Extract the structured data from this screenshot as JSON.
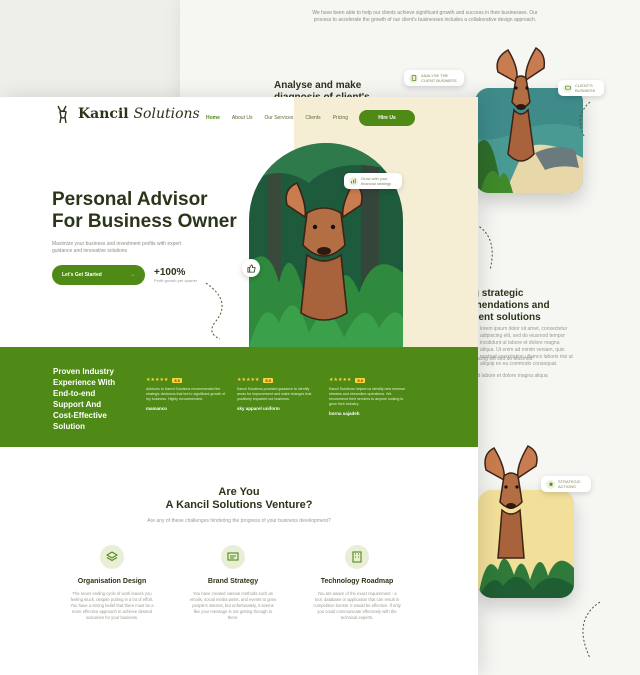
{
  "back": {
    "intro": "We have been able to help our clients achieve significant growth and success in their businesses. Our process to accelerate the growth of our client's businesses includes a collaborative design approach.",
    "section1_title": "Analyse and make\ndiagnosis of client's",
    "chip1": "ANALYSE THE\nCLIENT BUSINESS",
    "chip2": "CLIENT'S\nBUSINESS",
    "section2_title": "ing strategic\nmmendations and\nement solutions",
    "section2_body": "lorem ipsum dolor sit amet, consectetur adipiscing elit, sed do eiusmod tempor incididunt ut labore et dolore magna aliqua. Ut enim ad minim veniam, quis nostrud exercitation ullamco laboris nisi ut aliquip ex ea commodo consequat.",
    "bullet1": "acing elit sed do eiusmod",
    "bullet2": "ut labore et dolore magna aliqua",
    "chip3": "STRATEGIC\nACTIONS"
  },
  "header": {
    "brand_bold": "Kancil",
    "brand_script": "Solutions",
    "nav": [
      "Home",
      "About Us",
      "Our Services",
      "Clients",
      "Pricing"
    ],
    "hire": "Hire Us"
  },
  "hero": {
    "title": "Personal Advisor\nFor Business Owner",
    "subtitle": "Maximize your business and investment profits with expert guidance and innovative solutions",
    "cta": "Let's Get Started",
    "stat_value": "+100%",
    "stat_label": "Profit growth per quarter",
    "chip": "Grow with your\nfinancial strategy"
  },
  "band": {
    "title": "Proven Industry\nExperience With\nEnd-to-end\nSupport And\nCost-Effective\nSolution",
    "reviews": [
      {
        "rating": "5.0",
        "text": "Advisors to Kancil Solutions recommended the strategic decisions that led to significant growth of my business. Highly recommended.",
        "name": "mamanco"
      },
      {
        "rating": "5.0",
        "text": "Kancil Solutions provided guidance to identify areas for improvement and make changes that positively impacted our business.",
        "name": "sky apparel uniform"
      },
      {
        "rating": "5.0",
        "text": "Kancil Solutions helped us identify new revenue streams and streamline operations. We recommend their services to anyone looking to grow their industry.",
        "name": "borna sajadeh"
      }
    ]
  },
  "are_you": {
    "title": "Are You\nA Kancil Solutions Venture?",
    "subtitle": "Are any of these challenges hindering the progress of your business development?",
    "services": [
      {
        "title": "Organisation Design",
        "desc": "The never ending cycle of work leaves you feeling stuck, despite putting in a lot of effort. You have a strong belief that there must be a more effective approach to achieve desired outcomes for your business."
      },
      {
        "title": "Brand Strategy",
        "desc": "You have created various methods such as emails, social media posts, and events to grow people's interest, but unfortunately, it seems like your message is not getting through to them."
      },
      {
        "title": "Technology Roadmap",
        "desc": "You are aware of the exact requirement - a tool, database or application that can result in competitive boosts. It would be effective. If only you could communicate effectively with the technical experts."
      }
    ]
  },
  "colors": {
    "brand_green": "#4f8a16",
    "cream": "#f6edd5",
    "dark_text": "#2b3519"
  }
}
